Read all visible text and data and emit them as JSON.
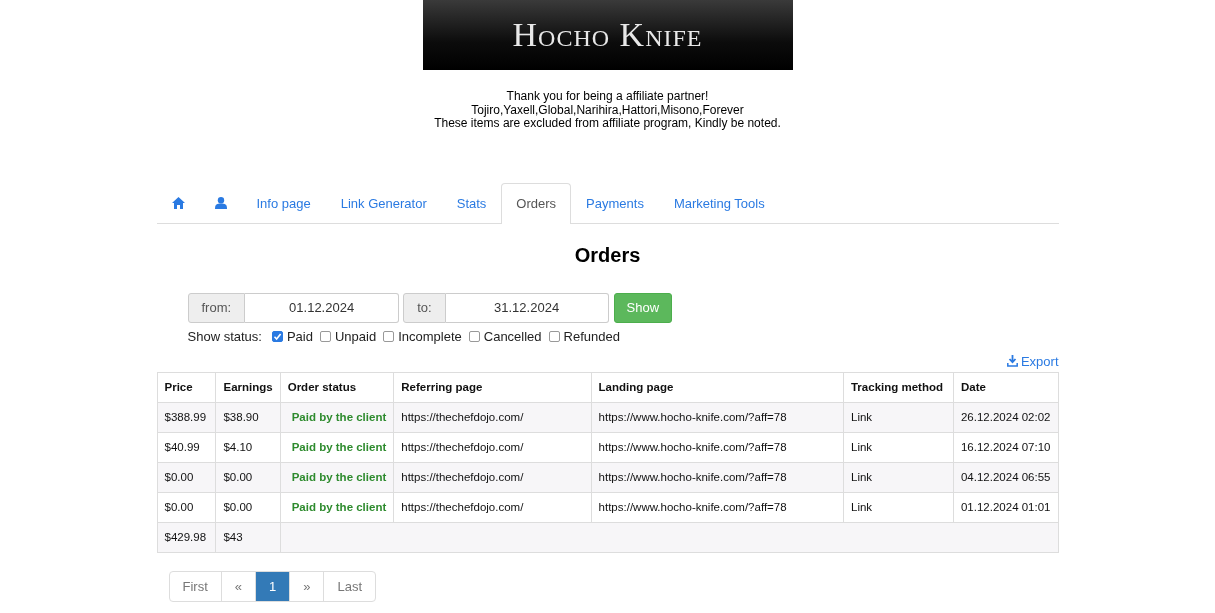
{
  "logo": {
    "text": "Hocho Knife"
  },
  "notice": [
    "Thank you for being a affiliate partner!",
    "Tojiro,Yaxell,Global,Narihira,Hattori,Misono,Forever",
    "These items are excluded from affiliate program, Kindly be noted."
  ],
  "tabs": [
    {
      "kind": "home",
      "selected": false
    },
    {
      "kind": "user",
      "selected": false
    },
    {
      "kind": "text",
      "label": "Info page",
      "selected": false
    },
    {
      "kind": "text",
      "label": "Link Generator",
      "selected": false
    },
    {
      "kind": "text",
      "label": "Stats",
      "selected": false
    },
    {
      "kind": "text",
      "label": "Orders",
      "selected": true
    },
    {
      "kind": "text",
      "label": "Payments",
      "selected": false
    },
    {
      "kind": "text",
      "label": "Marketing Tools",
      "selected": false
    }
  ],
  "heading": "Orders",
  "filter": {
    "from_label": "from:",
    "from_value": "01.12.2024",
    "to_label": "to:",
    "to_value": "31.12.2024",
    "button": "Show"
  },
  "status_filter": {
    "label": "Show status:",
    "options": [
      {
        "label": "Paid",
        "checked": true
      },
      {
        "label": "Unpaid",
        "checked": false
      },
      {
        "label": "Incomplete",
        "checked": false
      },
      {
        "label": "Cancelled",
        "checked": false
      },
      {
        "label": "Refunded",
        "checked": false
      }
    ]
  },
  "export": "Export",
  "table": {
    "columns": [
      "Price",
      "Earnings",
      "Order status",
      "Referring page",
      "Landing page",
      "Tracking method",
      "Date"
    ],
    "rows": [
      [
        "$388.99",
        "$38.90",
        "Paid by the client",
        "https://thechefdojo.com/",
        "https://www.hocho-knife.com/?aff=78",
        "Link",
        "26.12.2024 02:02"
      ],
      [
        "$40.99",
        "$4.10",
        "Paid by the client",
        "https://thechefdojo.com/",
        "https://www.hocho-knife.com/?aff=78",
        "Link",
        "16.12.2024 07:10"
      ],
      [
        "$0.00",
        "$0.00",
        "Paid by the client",
        "https://thechefdojo.com/",
        "https://www.hocho-knife.com/?aff=78",
        "Link",
        "04.12.2024 06:55"
      ],
      [
        "$0.00",
        "$0.00",
        "Paid by the client",
        "https://thechefdojo.com/",
        "https://www.hocho-knife.com/?aff=78",
        "Link",
        "01.12.2024 01:01"
      ]
    ],
    "totals": [
      "$429.98",
      "$43"
    ]
  },
  "pagination": [
    {
      "label": "First",
      "selected": false
    },
    {
      "label": "«",
      "selected": false
    },
    {
      "label": "1",
      "selected": true
    },
    {
      "label": "»",
      "selected": false
    },
    {
      "label": "Last",
      "selected": false
    }
  ]
}
